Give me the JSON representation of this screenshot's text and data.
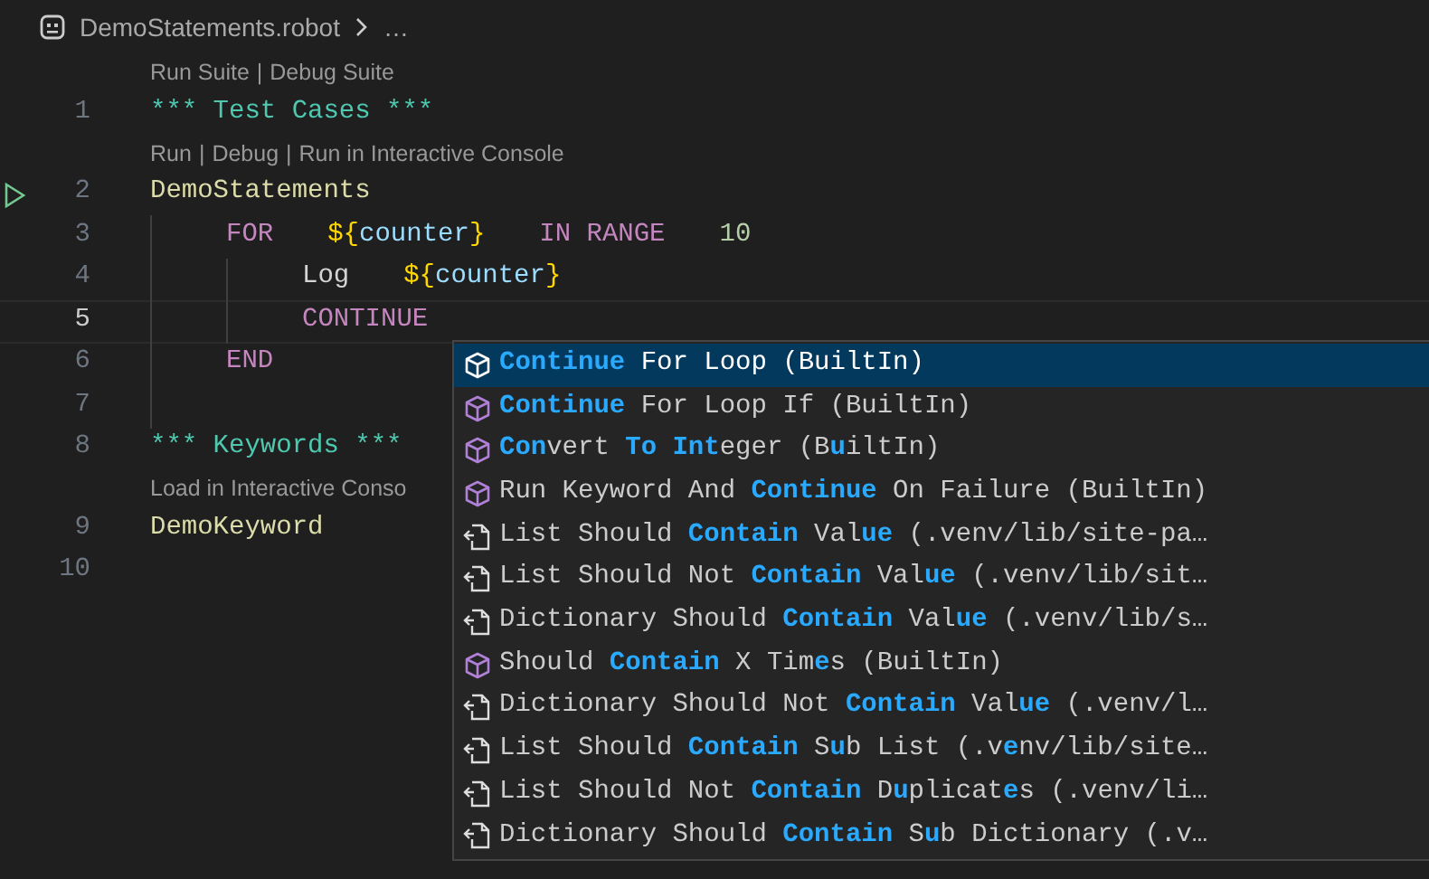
{
  "breadcrumb": {
    "file": "DemoStatements.robot",
    "more": "…"
  },
  "lines": [
    {
      "number": "1",
      "runnable": false,
      "current": false,
      "codelens": {
        "actions": [
          "Run Suite",
          "Debug Suite"
        ],
        "separator": "|"
      },
      "tokens": [
        {
          "kind": "header",
          "text": "*** Test Cases ***"
        }
      ]
    },
    {
      "number": "2",
      "runnable": true,
      "current": false,
      "codelens": {
        "actions": [
          "Run",
          "Debug",
          "Run in Interactive Console"
        ],
        "separator": "|"
      },
      "tokens": [
        {
          "kind": "name",
          "text": "DemoStatements"
        }
      ],
      "children": [
        {
          "number": "3",
          "runnable": false,
          "current": false,
          "tokens": [
            {
              "kind": "control",
              "text": "FOR"
            },
            {
              "kind": "variable",
              "open": "${",
              "name": "counter",
              "close": "}"
            },
            {
              "kind": "control",
              "text": "IN RANGE"
            },
            {
              "kind": "number",
              "text": "10"
            }
          ],
          "children": [
            {
              "number": "4",
              "runnable": false,
              "current": false,
              "tokens": [
                {
                  "kind": "keyword",
                  "text": "Log"
                },
                {
                  "kind": "variable",
                  "open": "${",
                  "name": "counter",
                  "close": "}"
                }
              ]
            },
            {
              "number": "5",
              "runnable": false,
              "current": true,
              "tokens": [
                {
                  "kind": "control",
                  "text": "CONTINUE"
                }
              ]
            }
          ]
        },
        {
          "number": "6",
          "runnable": false,
          "current": false,
          "tokens": [
            {
              "kind": "control",
              "text": "END"
            }
          ]
        },
        {
          "number": "7",
          "runnable": false,
          "current": false
        }
      ]
    },
    {
      "number": "8",
      "runnable": false,
      "current": false,
      "tokens": [
        {
          "kind": "header",
          "text": "*** Keywords ***"
        }
      ]
    },
    {
      "number": "9",
      "runnable": false,
      "current": false,
      "codelens": {
        "actions": [
          "Load in Interactive Conso"
        ]
      },
      "tokens": [
        {
          "kind": "name",
          "text": "DemoKeyword"
        }
      ]
    },
    {
      "number": "10",
      "runnable": false,
      "current": false
    }
  ],
  "suggestions": [
    {
      "kind": "builtin",
      "selected": true,
      "label": "**Continue** For Loop (BuiltIn)"
    },
    {
      "kind": "builtin",
      "selected": false,
      "label": "**Continue** For Loop If (BuiltIn)"
    },
    {
      "kind": "builtin",
      "selected": false,
      "label": "**Con**vert **To** **Int**eger (B**u**iltIn)"
    },
    {
      "kind": "builtin",
      "selected": false,
      "label": "Run Keyword And **Continue** On Failure (BuiltIn)"
    },
    {
      "kind": "library",
      "selected": false,
      "label": "List Should **Contain** Val**ue** (.venv/lib/site-pa…"
    },
    {
      "kind": "library",
      "selected": false,
      "label": "List Should Not **Contain** Val**ue** (.venv/lib/sit…"
    },
    {
      "kind": "library",
      "selected": false,
      "label": "Dictionary Should **Contain** Val**ue** (.venv/lib/s…"
    },
    {
      "kind": "builtin",
      "selected": false,
      "label": "Should **Contain** X Tim**e**s (BuiltIn)"
    },
    {
      "kind": "library",
      "selected": false,
      "label": "Dictionary Should Not **Contain** Val**ue** (.venv/l…"
    },
    {
      "kind": "library",
      "selected": false,
      "label": "List Should **Contain** S**u**b List (.v**e**nv/lib/site…"
    },
    {
      "kind": "library",
      "selected": false,
      "label": "List Should Not **Contain** D**u**plicat**e**s (.venv/li…"
    },
    {
      "kind": "library",
      "selected": false,
      "label": "Dictionary Should **Contain** S**u**b Dictionary (.v…"
    }
  ]
}
